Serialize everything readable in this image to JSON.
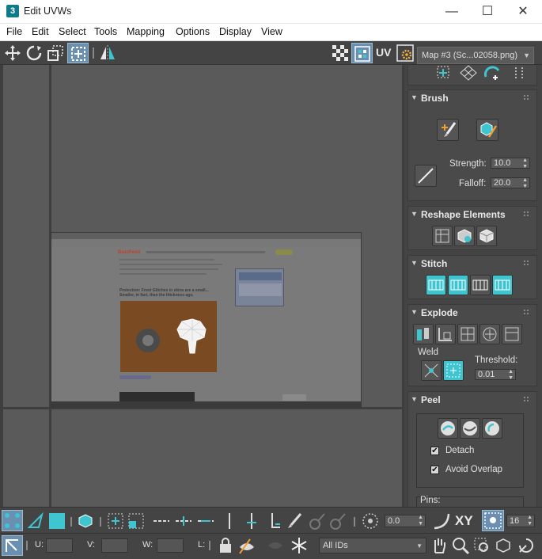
{
  "window": {
    "title": "Edit UVWs",
    "app_icon": "3",
    "buttons": {
      "minimize": "—",
      "maximize": "☐",
      "close": "✕"
    }
  },
  "menu": {
    "items": [
      "File",
      "Edit",
      "Select",
      "Tools",
      "Mapping",
      "Options",
      "Display",
      "View"
    ]
  },
  "toolbar": {
    "uv_label": "UV",
    "map_select": "Map #3 (Sc...02058.png)"
  },
  "viewport": {
    "image_caption": "Protection: Frost Glitches in skins are a small... Smaller, in fact, than the thickness ago.",
    "site_name": "BuzzFeed"
  },
  "panel": {
    "brush": {
      "title": "Brush",
      "strength_label": "Strength:",
      "strength_value": "10.0",
      "falloff_label": "Falloff:",
      "falloff_value": "20.0"
    },
    "reshape": {
      "title": "Reshape Elements"
    },
    "stitch": {
      "title": "Stitch"
    },
    "explode": {
      "title": "Explode",
      "weld_label": "Weld",
      "threshold_label": "Threshold:",
      "threshold_value": "0.01"
    },
    "peel": {
      "title": "Peel",
      "detach_label": "Detach",
      "detach_checked": true,
      "avoid_overlap_label": "Avoid Overlap",
      "avoid_overlap_checked": true,
      "pins_label": "Pins:"
    }
  },
  "bottombar": {
    "spinner_value": "0.0",
    "xy_label": "XY",
    "grid_value": "16",
    "u_label": "U:",
    "v_label": "V:",
    "w_label": "W:",
    "l_label": "L:",
    "ids_select": "All IDs"
  },
  "colors": {
    "accent_cyan": "#3fc5d0",
    "panel_bg": "#444444",
    "viewport_bg": "#5d5d5d",
    "active_btn": "#6a8fb0"
  }
}
